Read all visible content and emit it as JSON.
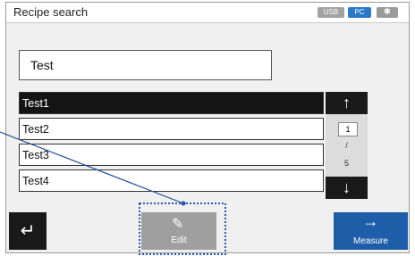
{
  "header": {
    "title": "Recipe search",
    "badges": {
      "usb": "USB",
      "pc": "PC",
      "bluetooth": "✱"
    }
  },
  "search": {
    "value": "Test"
  },
  "list": {
    "items": [
      {
        "label": "Test1",
        "selected": true
      },
      {
        "label": "Test2",
        "selected": false
      },
      {
        "label": "Test3",
        "selected": false
      },
      {
        "label": "Test4",
        "selected": false
      }
    ]
  },
  "pager": {
    "current": "1",
    "separator": "/",
    "total": "5"
  },
  "buttons": {
    "back_icon": "return-arrow-icon",
    "edit_label": "Edit",
    "measure_label": "Measure"
  },
  "colors": {
    "accent": "#1e5ea8",
    "selection": "#141414",
    "disabled": "#9f9f9f"
  }
}
